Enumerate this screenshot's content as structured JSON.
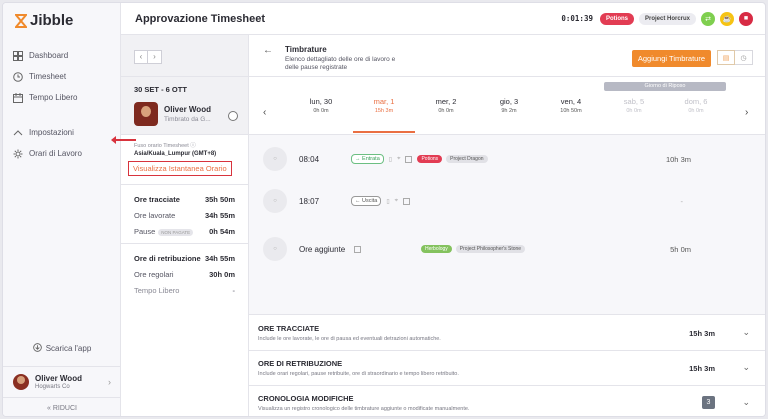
{
  "app": {
    "name": "Jibble"
  },
  "sidebar": {
    "items": [
      {
        "label": "Dashboard",
        "icon": "dashboard-icon"
      },
      {
        "label": "Timesheet",
        "icon": "clock-icon"
      },
      {
        "label": "Tempo Libero",
        "icon": "calendar-icon"
      }
    ],
    "settings": [
      {
        "label": "Impostazioni",
        "icon": "chevron-up-icon"
      },
      {
        "label": "Orari di Lavoro",
        "icon": "settings-icon"
      }
    ],
    "download_label": "Scarica l'app",
    "user": {
      "name": "Oliver Wood",
      "org": "Hogwarts Co"
    },
    "collapse_label": "RIDUCI"
  },
  "header": {
    "title": "Approvazione Timesheet",
    "timer": "0:01:39",
    "activity": "Potions",
    "project": "Project Horcrux"
  },
  "period": {
    "range": "30 SET - 6 OTT",
    "employee_name": "Oliver Wood",
    "employee_sub": "Timbrato da G..."
  },
  "timezone": {
    "label": "Fuso orario Timesheet ⓘ",
    "value": "Asia/Kuala_Lumpur (GMT+8)",
    "link": "Visualizza Istantanea Orario"
  },
  "stats": [
    {
      "label": "Ore tracciate",
      "value": "35h 50m",
      "style": "bold"
    },
    {
      "label": "Ore lavorate",
      "value": "34h 55m",
      "style": "normal"
    },
    {
      "label": "Pause",
      "chip": "NON PAGATE",
      "value": "0h 54m",
      "style": "normal"
    }
  ],
  "stats2": [
    {
      "label": "Ore di retribuzione",
      "value": "34h 55m",
      "style": "bold"
    },
    {
      "label": "Ore regolari",
      "value": "30h 0m",
      "style": "normal"
    },
    {
      "label": "Tempo Libero",
      "value": "-",
      "style": "muted"
    }
  ],
  "detail": {
    "title": "Timbrature",
    "subtitle": "Elenco dettagliato delle ore di lavoro e delle pause registrate",
    "add_button": "Aggiungi Timbrature"
  },
  "days": {
    "rest_label": "Giorno di Riposo",
    "items": [
      {
        "name": "lun, 30",
        "hours": "0h 0m",
        "state": "normal"
      },
      {
        "name": "mar, 1",
        "hours": "15h 3m",
        "state": "active"
      },
      {
        "name": "mer, 2",
        "hours": "0h 0m",
        "state": "normal"
      },
      {
        "name": "gio, 3",
        "hours": "9h 2m",
        "state": "normal"
      },
      {
        "name": "ven, 4",
        "hours": "10h 50m",
        "state": "normal"
      },
      {
        "name": "sab, 5",
        "hours": "0h 0m",
        "state": "dim"
      },
      {
        "name": "dom, 6",
        "hours": "0h 0m",
        "state": "dim"
      }
    ]
  },
  "entries": [
    {
      "time": "08:04",
      "tag": "Entrata",
      "activity": "Potions",
      "project": "Project Dragon",
      "duration": "10h 3m"
    },
    {
      "time": "18:07",
      "tag": "Uscita",
      "duration": "-"
    },
    {
      "time": "Ore aggiunte",
      "activity": "Herbology",
      "project": "Project Philosopher's Stone",
      "duration": "5h 0m"
    }
  ],
  "summaries": [
    {
      "title": "ORE TRACCIATE",
      "desc": "Include le ore lavorate, le ore di pausa ed eventuali detrazioni automatiche.",
      "value": "15h 3m"
    },
    {
      "title": "ORE DI RETRIBUZIONE",
      "desc": "Include orari regolari, pause retribuite, ore di straordinario e tempo libero retribuito.",
      "value": "15h 3m"
    },
    {
      "title": "CRONOLOGIA MODIFICHE",
      "desc": "Visualizza un registro cronologico delle timbrature aggiunte o modificate manualmente.",
      "count": "3"
    }
  ],
  "colors": {
    "accent": "#ea6f42",
    "brand": "#f08a2c",
    "potions": "#e23c53",
    "herbology": "#84c25e"
  }
}
